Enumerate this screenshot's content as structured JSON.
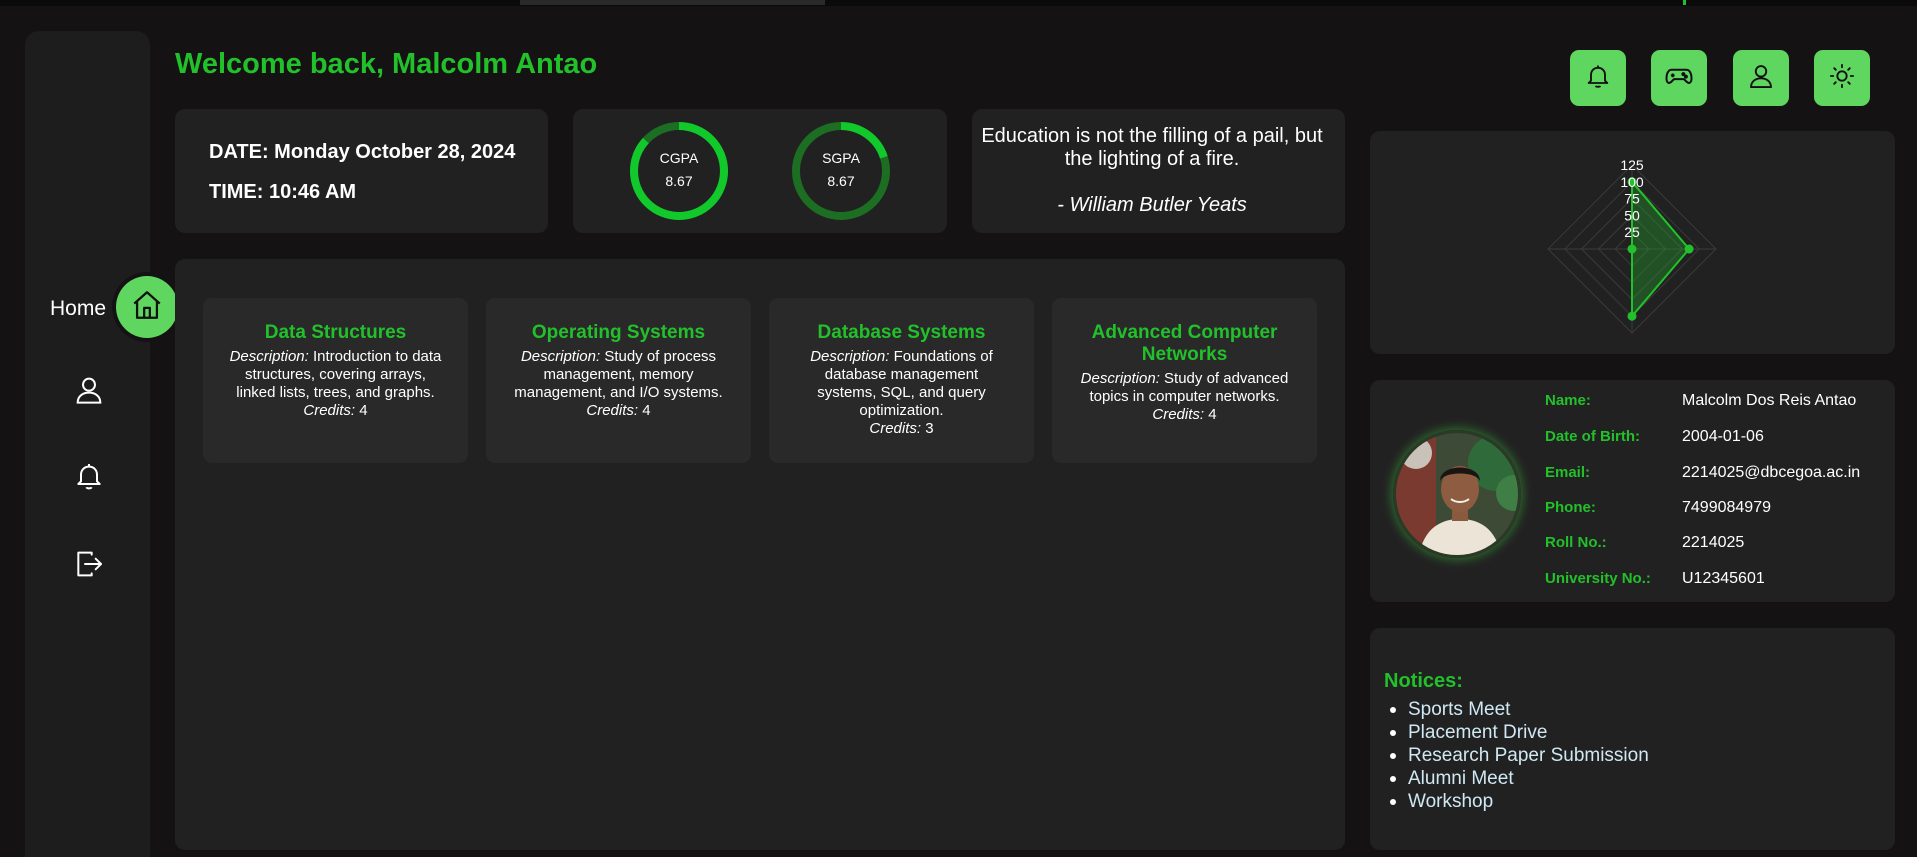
{
  "sidebar": {
    "home_label": "Home",
    "items": [
      {
        "icon": "home-icon"
      },
      {
        "icon": "user-icon"
      },
      {
        "icon": "bell-icon"
      },
      {
        "icon": "logout-icon"
      }
    ]
  },
  "header": {
    "welcome": "Welcome back, Malcolm Antao",
    "actions": [
      {
        "icon": "bell-icon"
      },
      {
        "icon": "gamepad-icon"
      },
      {
        "icon": "user-icon"
      },
      {
        "icon": "sun-icon"
      }
    ]
  },
  "datetime": {
    "date": "DATE: Monday October 28, 2024",
    "time": "TIME: 10:46 AM"
  },
  "grades": [
    {
      "label": "CGPA",
      "value": "8.67",
      "progress": 0.867
    },
    {
      "label": "SGPA",
      "value": "8.67",
      "progress": 0.2
    }
  ],
  "quote": {
    "text": "Education is not the filling of a pail, but the lighting of a fire.",
    "author": "- William Butler Yeats"
  },
  "courses": [
    {
      "title": "Data Structures",
      "desc_label": "Description:",
      "desc": "Introduction to data structures, covering arrays, linked lists, trees, and graphs.",
      "credits_label": "Credits:",
      "credits": "4"
    },
    {
      "title": "Operating Systems",
      "desc_label": "Description:",
      "desc": "Study of process management, memory management, and I/O systems.",
      "credits_label": "Credits:",
      "credits": "4"
    },
    {
      "title": "Database Systems",
      "desc_label": "Description:",
      "desc": "Foundations of database management systems, SQL, and query optimization.",
      "credits_label": "Credits:",
      "credits": "3"
    },
    {
      "title": "Advanced Computer Networks",
      "desc_label": "Description:",
      "desc": "Study of advanced topics in computer networks.",
      "credits_label": "Credits:",
      "credits": "4"
    }
  ],
  "chart_data": {
    "type": "radar",
    "tick_labels": [
      "125",
      "100",
      "75",
      "50",
      "25"
    ],
    "ticks": [
      25,
      50,
      75,
      100,
      125
    ],
    "max": 125,
    "values": [
      100,
      85,
      100,
      0
    ],
    "color": "#22c02a"
  },
  "profile": {
    "fields": [
      {
        "label": "Name:",
        "value": "Malcolm Dos Reis Antao"
      },
      {
        "label": "Date of Birth:",
        "value": "2004-01-06"
      },
      {
        "label": "Email:",
        "value": "2214025@dbcegoa.ac.in"
      },
      {
        "label": "Phone:",
        "value": "7499084979"
      },
      {
        "label": "Roll No.:",
        "value": "2214025"
      },
      {
        "label": "University No.:",
        "value": "U12345601"
      }
    ]
  },
  "notices": {
    "title": "Notices:",
    "items": [
      "Sports Meet",
      "Placement Drive",
      "Research Paper Submission",
      "Alumni Meet",
      "Workshop"
    ]
  },
  "colors": {
    "accent": "#22c02a",
    "button": "#5fd65f",
    "card": "#222122",
    "background": "#141212"
  }
}
